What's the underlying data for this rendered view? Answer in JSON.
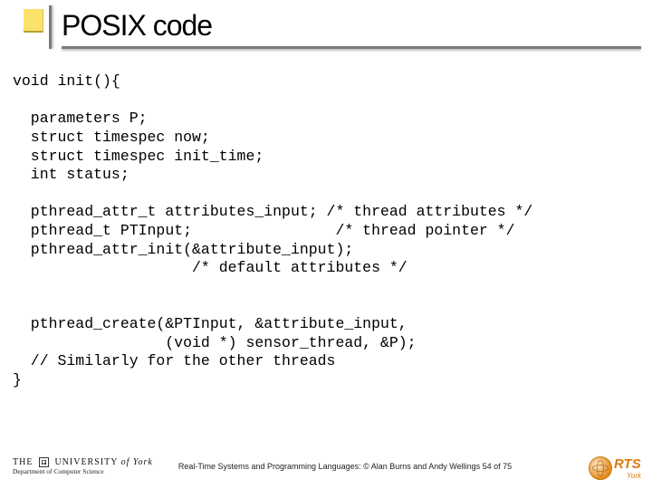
{
  "title": "POSIX code",
  "code": "void init(){\n\n  parameters P;\n  struct timespec now;\n  struct timespec init_time;\n  int status;\n\n  pthread_attr_t attributes_input; /* thread attributes */\n  pthread_t PTInput;                /* thread pointer */\n  pthread_attr_init(&attribute_input);\n                    /* default attributes */\n\n\n  pthread_create(&PTInput, &attribute_input,\n                 (void *) sensor_thread, &P);\n  // Similarly for the other threads\n}",
  "footer": {
    "uni_top_left": "THE",
    "uni_top_mid": "UNIVERSITY",
    "uni_top_right": "of York",
    "uni_bottom": "Department of Computer Science",
    "caption": "Real-Time Systems and Programming Languages: © Alan Burns and Andy Wellings  54 of 75",
    "rts_text": "RTS",
    "rts_sub": "York"
  }
}
